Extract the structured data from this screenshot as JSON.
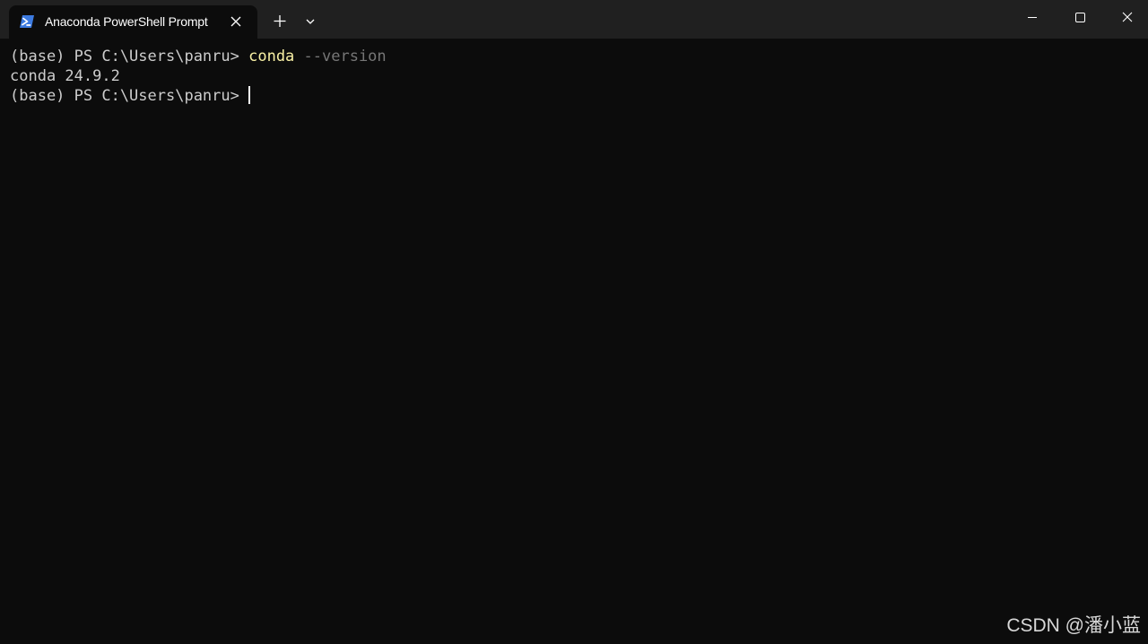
{
  "tab": {
    "title": "Anaconda PowerShell Prompt",
    "icon": "powershell-icon"
  },
  "titlebar": {
    "new_tab_icon": "plus-icon",
    "dropdown_icon": "chevron-down-icon",
    "minimize_icon": "minimize-icon",
    "maximize_icon": "maximize-icon",
    "close_icon": "close-icon"
  },
  "terminal": {
    "lines": [
      {
        "prompt": "(base) PS C:\\Users\\panru> ",
        "command": "conda",
        "argument": " --version"
      },
      {
        "output": "conda 24.9.2"
      },
      {
        "prompt": "(base) PS C:\\Users\\panru> "
      }
    ]
  },
  "watermark": "CSDN @潘小蓝",
  "colors": {
    "background": "#0c0c0c",
    "titlebar": "#202020",
    "text": "#cccccc",
    "command": "#f9f1a5",
    "argument": "#767676"
  }
}
